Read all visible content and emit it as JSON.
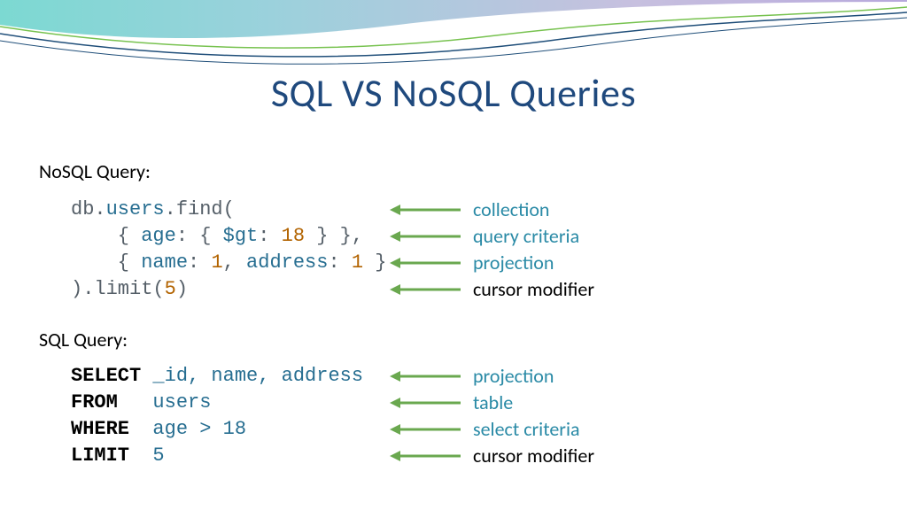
{
  "title": "SQL VS NoSQL Queries",
  "labels": {
    "nosql": "NoSQL Query:",
    "sql": "SQL Query:"
  },
  "nosql_code": {
    "l1_a": "db.",
    "l1_b": "users",
    "l1_c": ".find(",
    "l2_a": "    { ",
    "l2_b": "age",
    "l2_c": ": { ",
    "l2_d": "$gt",
    "l2_e": ": ",
    "l2_f": "18",
    "l2_g": " } },",
    "l3_a": "    { ",
    "l3_b": "name",
    "l3_c": ": ",
    "l3_d": "1",
    "l3_e": ", ",
    "l3_f": "address",
    "l3_g": ": ",
    "l3_h": "1",
    "l3_i": " }",
    "l4_a": ").limit(",
    "l4_b": "5",
    "l4_c": ")"
  },
  "nosql_annot": [
    {
      "text": "collection",
      "style": "teal"
    },
    {
      "text": "query criteria",
      "style": "teal"
    },
    {
      "text": "projection",
      "style": "teal"
    },
    {
      "text": "cursor modifier",
      "style": "black"
    }
  ],
  "sql_code": {
    "l1_kw": "SELECT ",
    "l1_v": "_id, name, address",
    "l2_kw": "FROM   ",
    "l2_v": "users",
    "l3_kw": "WHERE  ",
    "l3_v": "age > 18",
    "l4_kw": "LIMIT  ",
    "l4_v": "5"
  },
  "sql_annot": [
    {
      "text": "projection",
      "style": "teal"
    },
    {
      "text": "table",
      "style": "teal"
    },
    {
      "text": "select criteria",
      "style": "teal"
    },
    {
      "text": "cursor modifier",
      "style": "black"
    }
  ]
}
